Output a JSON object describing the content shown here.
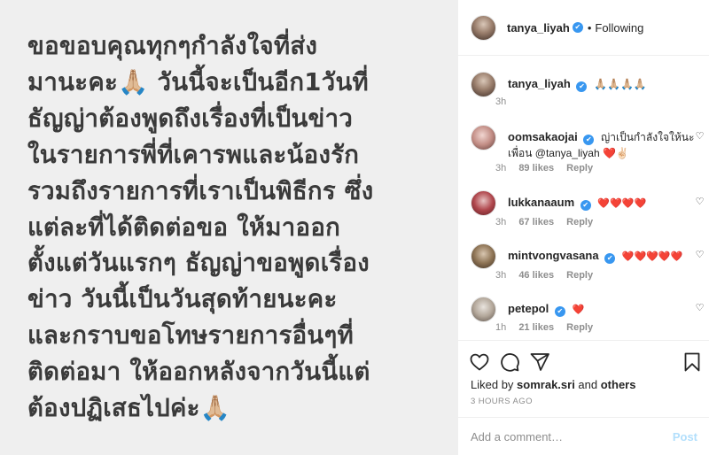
{
  "post": {
    "lines": [
      "ขอขอบคุณทุกๆกำลังใจที่ส่ง",
      "มานะคะ🙏🏼  วันนี้จะเป็นอีก1วันที่",
      "ธัญญ่าต้องพูดถึงเรื่องที่เป็นข่าว",
      "ในรายการพี่ที่เคารพและน้องรัก",
      "รวมถึงรายการที่เราเป็นพิธีกร ซึ่ง",
      "แต่ละที่ได้ติดต่อขอ ให้มาออก",
      "ตั้งแต่วันแรกๆ ธัญญ่าขอพูดเรื่อง",
      "ข่าว  วันนี้เป็นวันสุดท้ายนะคะ",
      "และกราบขอโทษรายการอื่นๆที่",
      "ติดต่อมา ให้ออกหลังจากวันนี้แต่",
      "ต้องปฏิเสธไปค่ะ🙏🏼"
    ]
  },
  "header": {
    "username": "tanya_liyah",
    "verified_mark": "✔",
    "separator": "•",
    "follow_status": "Following"
  },
  "caption": {
    "username": "tanya_liyah",
    "text": "🙏🏼🙏🏼🙏🏼🙏🏼",
    "time": "3h"
  },
  "comments": [
    {
      "username": "oomsakaojai",
      "text": "ญ่าเป็นกำลังใจให้นะเพื่อน @tanya_liyah ❤️✌🏻",
      "time": "3h",
      "likes": "89 likes",
      "reply": "Reply"
    },
    {
      "username": "lukkanaaum",
      "text": "❤️❤️❤️❤️",
      "time": "3h",
      "likes": "67 likes",
      "reply": "Reply"
    },
    {
      "username": "mintvongvasana",
      "text": "❤️❤️❤️❤️❤️",
      "time": "3h",
      "likes": "46 likes",
      "reply": "Reply"
    },
    {
      "username": "petepol",
      "text": "❤️",
      "time": "1h",
      "likes": "21 likes",
      "reply": "Reply"
    }
  ],
  "actions": {
    "liked_by_prefix": "Liked by ",
    "liked_by_user": "somrak.sri",
    "liked_by_and": " and ",
    "liked_by_others": "others",
    "time_ago": "3 HOURS AGO"
  },
  "add_comment": {
    "placeholder": "Add a comment…",
    "post_label": "Post"
  },
  "icons": {
    "like": "heart-outline-icon",
    "comment": "comment-bubble-icon",
    "share": "paper-plane-icon",
    "save": "bookmark-icon",
    "comment_like": "small-heart-icon"
  },
  "colors": {
    "verified": "#3897f0",
    "heart": "#ed4956",
    "post_button": "#b2dffc",
    "muted": "#8e8e8e",
    "image_bg": "#efefef"
  }
}
